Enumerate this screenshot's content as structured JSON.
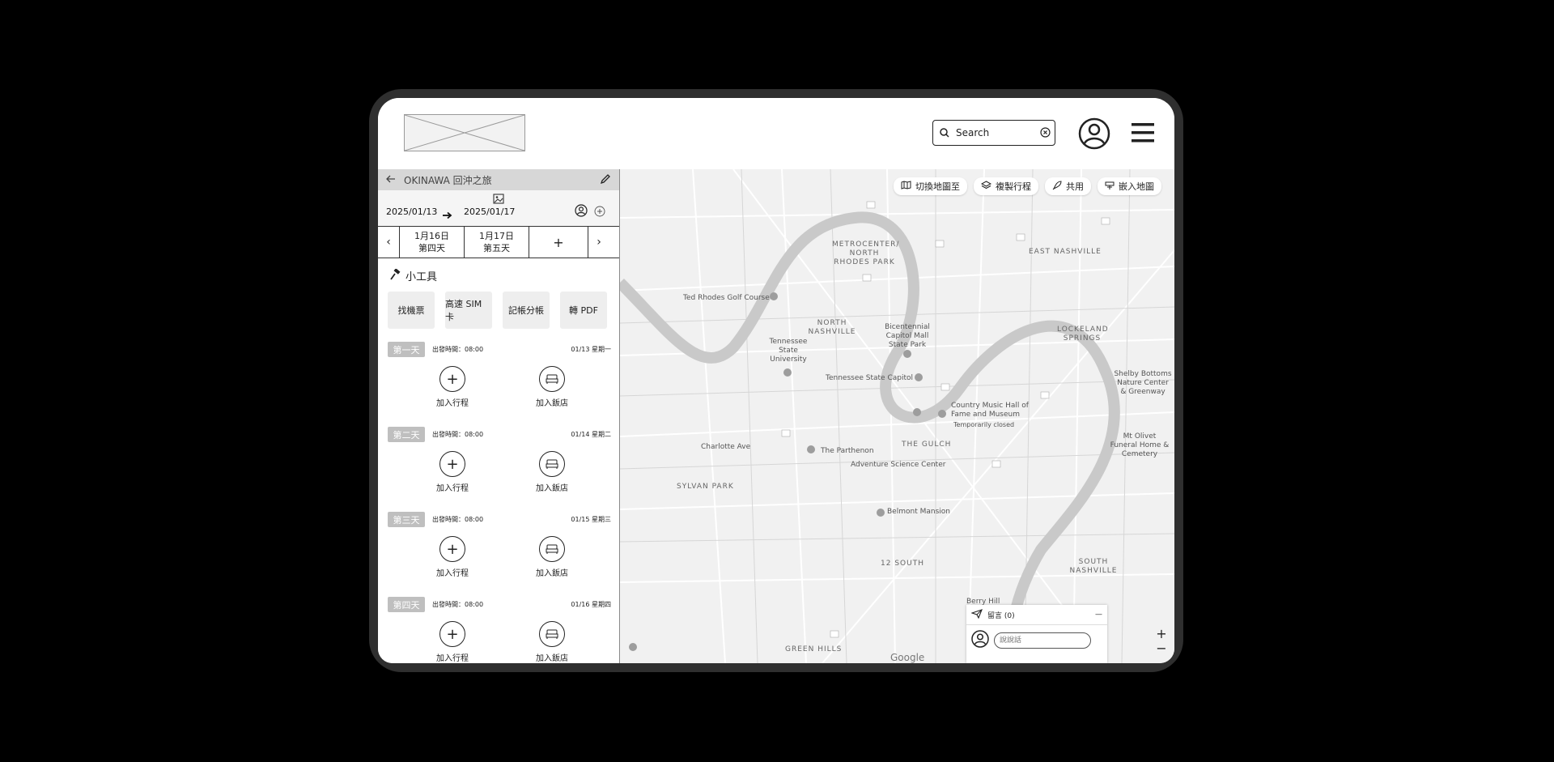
{
  "header": {
    "search_placeholder": "Search"
  },
  "trip": {
    "title": "OKINAWA 回沖之旅",
    "start_date": "2025/01/13",
    "end_date": "2025/01/17"
  },
  "day_tabs": [
    {
      "date": "1月16日",
      "day": "第四天"
    },
    {
      "date": "1月17日",
      "day": "第五天"
    }
  ],
  "add_tab_label": "+",
  "tools": {
    "title": "小工具",
    "items": [
      "找機票",
      "高速 SIM 卡",
      "記帳分帳",
      "轉 PDF"
    ]
  },
  "days": [
    {
      "badge": "第一天",
      "departure": "出發時間：08:00",
      "date": "01/13 星期一"
    },
    {
      "badge": "第二天",
      "departure": "出發時間：08:00",
      "date": "01/14 星期二"
    },
    {
      "badge": "第三天",
      "departure": "出發時間：08:00",
      "date": "01/15 星期三"
    },
    {
      "badge": "第四天",
      "departure": "出發時間：08:00",
      "date": "01/16 星期四"
    }
  ],
  "day_actions": {
    "add_plan": "加入行程",
    "add_hotel": "加入飯店"
  },
  "map": {
    "buttons": [
      "切換地圖至",
      "複製行程",
      "共用",
      "嵌入地圖"
    ],
    "places": {
      "metrocenter": "METROCENTER/ NORTH RHODES PARK",
      "east_nashville": "EAST NASHVILLE",
      "lockeland": "LOCKELAND SPRINGS",
      "ted_rhodes": "Ted Rhodes Golf Course",
      "north_nashville": "NORTH NASHVILLE",
      "bicentennial": "Bicentennial Capitol Mall State Park",
      "tsu": "Tennessee State University",
      "capitol": "Tennessee State Capitol",
      "shelby": "Shelby Bottoms Nature Center & Greenway",
      "cmhof": "Country Music Hall of Fame and Museum",
      "temp_closed": "Temporarily closed",
      "charlotte": "Charlotte Ave",
      "parthenon": "The Parthenon",
      "gulch": "THE GULCH",
      "adventure": "Adventure Science Center",
      "mt_olivet": "Mt Olivet Funeral Home & Cemetery",
      "sylvan": "SYLVAN PARK",
      "belmont": "Belmont Mansion",
      "twelve_south": "12 SOUTH",
      "south_nashville": "SOUTH NASHVILLE",
      "green_hills": "GREEN HILLS",
      "berry_hill": "Berry Hill"
    },
    "google": "Google",
    "zoom_in": "+",
    "zoom_out": "−"
  },
  "chat": {
    "title": "留言 (0)",
    "minimize": "—",
    "placeholder": "說說話"
  }
}
